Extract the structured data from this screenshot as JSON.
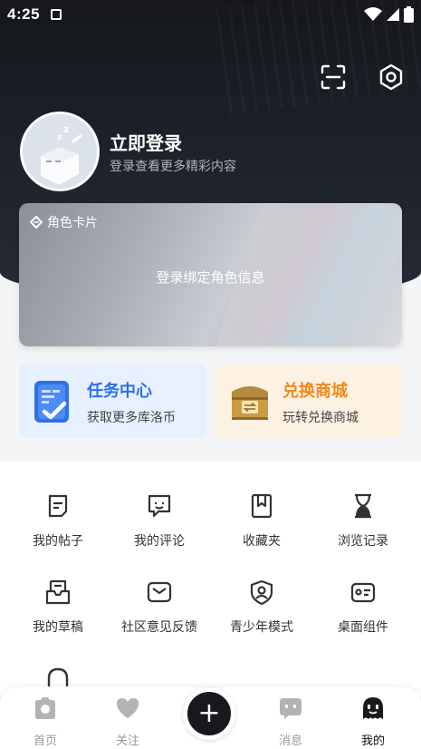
{
  "status_bar": {
    "time": "4:25"
  },
  "header": {
    "actions": [
      {
        "icon": "scan-icon"
      },
      {
        "icon": "settings-icon"
      }
    ]
  },
  "profile": {
    "title": "立即登录",
    "subtitle": "登录查看更多精彩内容"
  },
  "role_card": {
    "label": "角色卡片",
    "message": "登录绑定角色信息"
  },
  "promos": [
    {
      "title": "任务中心",
      "subtitle": "获取更多库洛币",
      "color": "#2e6fea"
    },
    {
      "title": "兑换商城",
      "subtitle": "玩转兑换商城",
      "color": "#f08a1c"
    }
  ],
  "menu": [
    {
      "label": "我的帖子",
      "icon": "post-icon"
    },
    {
      "label": "我的评论",
      "icon": "comment-icon"
    },
    {
      "label": "收藏夹",
      "icon": "bookmark-icon"
    },
    {
      "label": "浏览记录",
      "icon": "hourglass-icon"
    },
    {
      "label": "我的草稿",
      "icon": "draft-tray-icon"
    },
    {
      "label": "社区意见反馈",
      "icon": "mail-icon"
    },
    {
      "label": "青少年模式",
      "icon": "shield-user-icon"
    },
    {
      "label": "桌面组件",
      "icon": "widget-card-icon"
    },
    {
      "label": "",
      "icon": "headset-icon"
    }
  ],
  "tabbar": {
    "tabs": [
      {
        "label": "首页",
        "icon": "camera-home-icon",
        "active": false
      },
      {
        "label": "关注",
        "icon": "heart-icon",
        "active": false
      },
      {
        "label": "消息",
        "icon": "chat-face-icon",
        "active": false
      },
      {
        "label": "我的",
        "icon": "ghost-face-icon",
        "active": true
      }
    ],
    "fab_icon": "plus-icon",
    "fab_label": "+"
  }
}
